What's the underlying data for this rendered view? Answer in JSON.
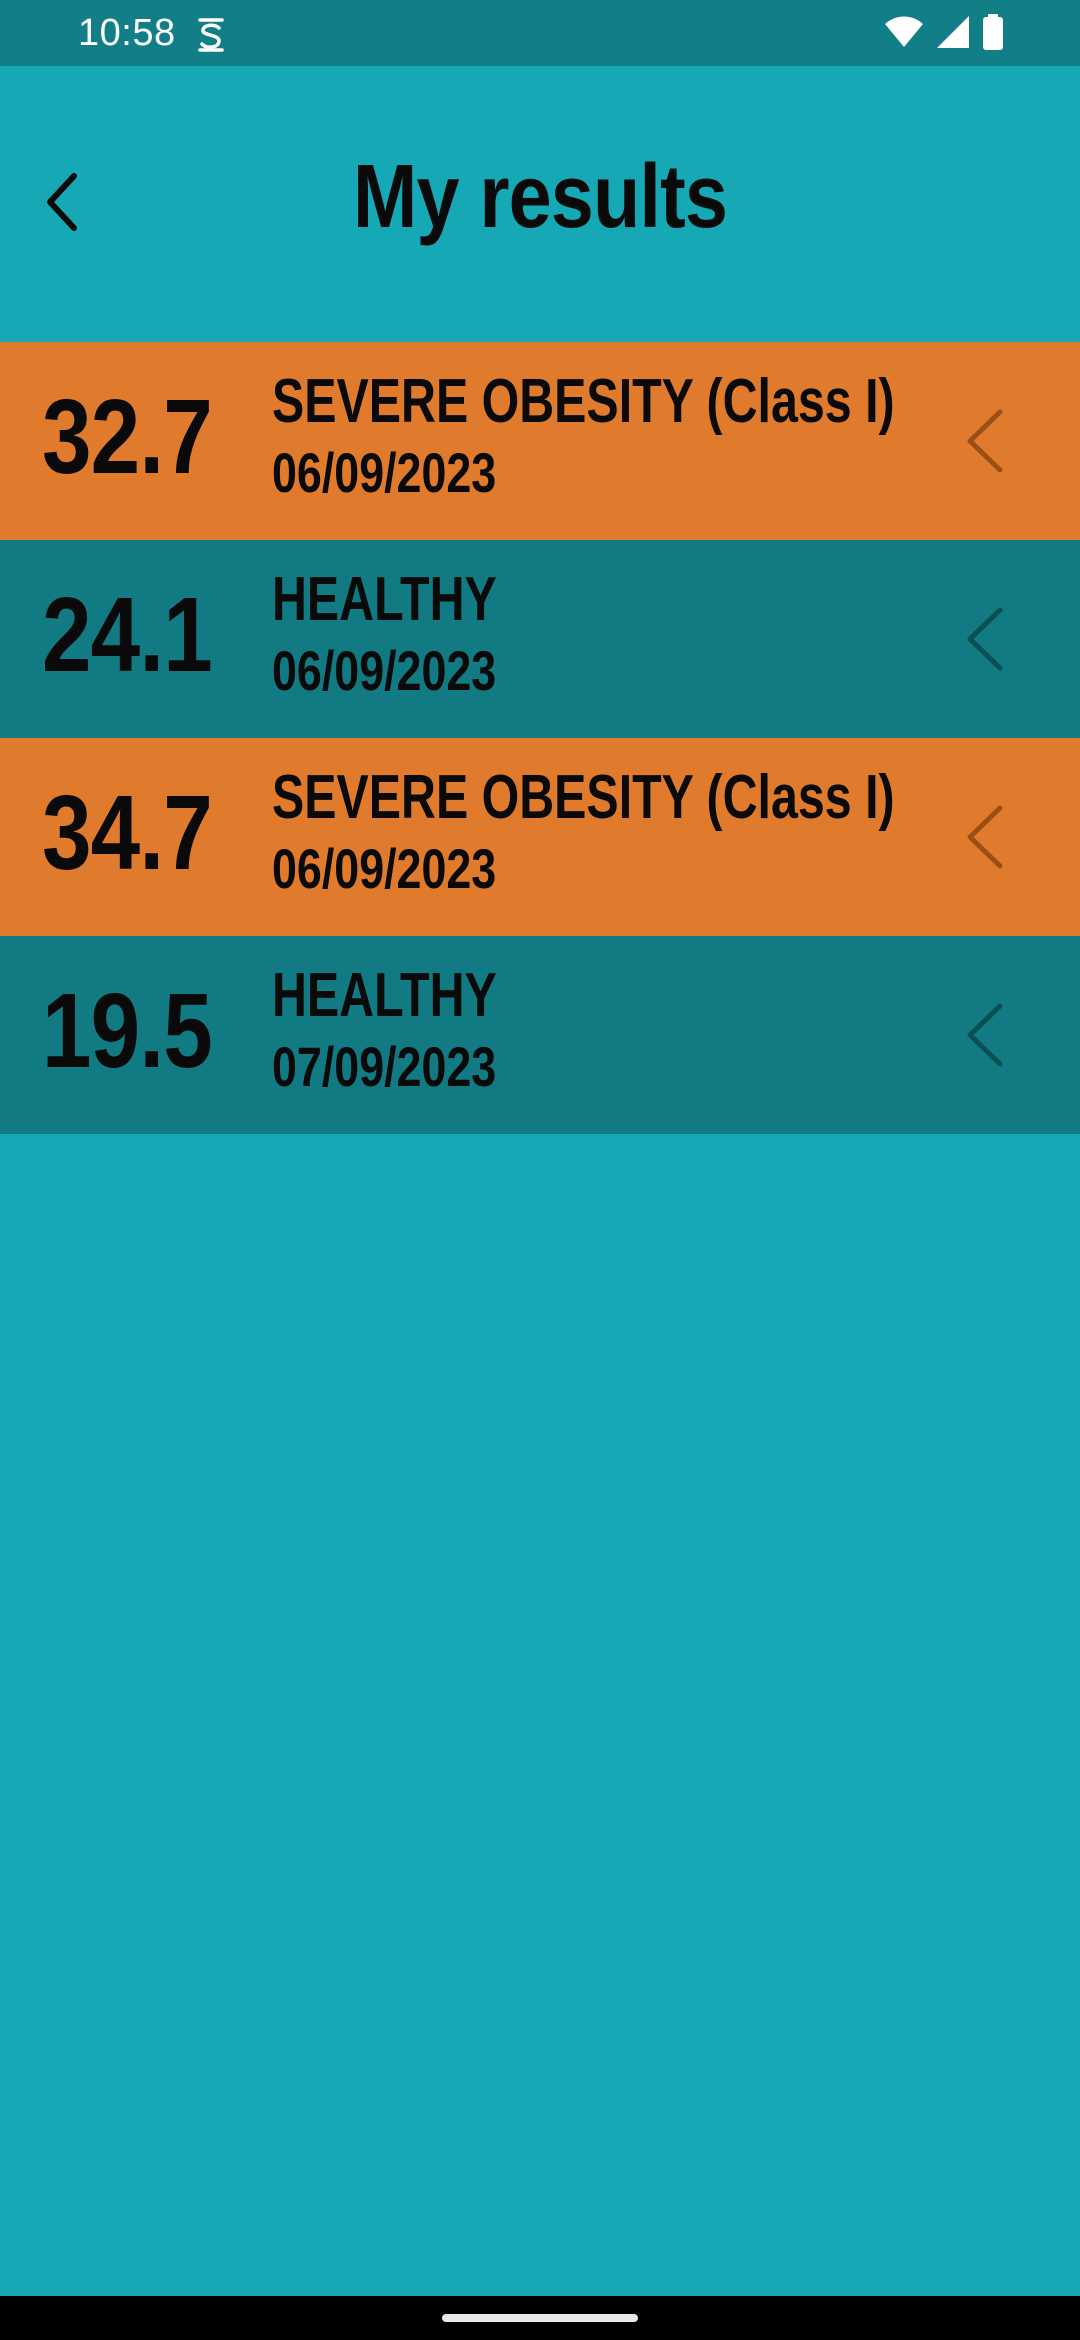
{
  "status_bar": {
    "time": "10:58",
    "app_icon": "s-notification-icon",
    "wifi_icon": "wifi-icon",
    "signal_icon": "cell-signal-icon",
    "battery_icon": "battery-icon"
  },
  "header": {
    "title": "My results",
    "back_icon": "chevron-left-icon"
  },
  "colors": {
    "background": "#17a8b6",
    "status_bar": "#117e88",
    "obese_row": "#e07b2e",
    "healthy_row": "#117a82"
  },
  "results": [
    {
      "value": "32.7",
      "category": "SEVERE OBESITY (Class I)",
      "date": "06/09/2023",
      "status": "obese"
    },
    {
      "value": "24.1",
      "category": "HEALTHY",
      "date": "06/09/2023",
      "status": "healthy"
    },
    {
      "value": "34.7",
      "category": "SEVERE OBESITY (Class I)",
      "date": "06/09/2023",
      "status": "obese"
    },
    {
      "value": "19.5",
      "category": "HEALTHY",
      "date": "07/09/2023",
      "status": "healthy"
    }
  ]
}
